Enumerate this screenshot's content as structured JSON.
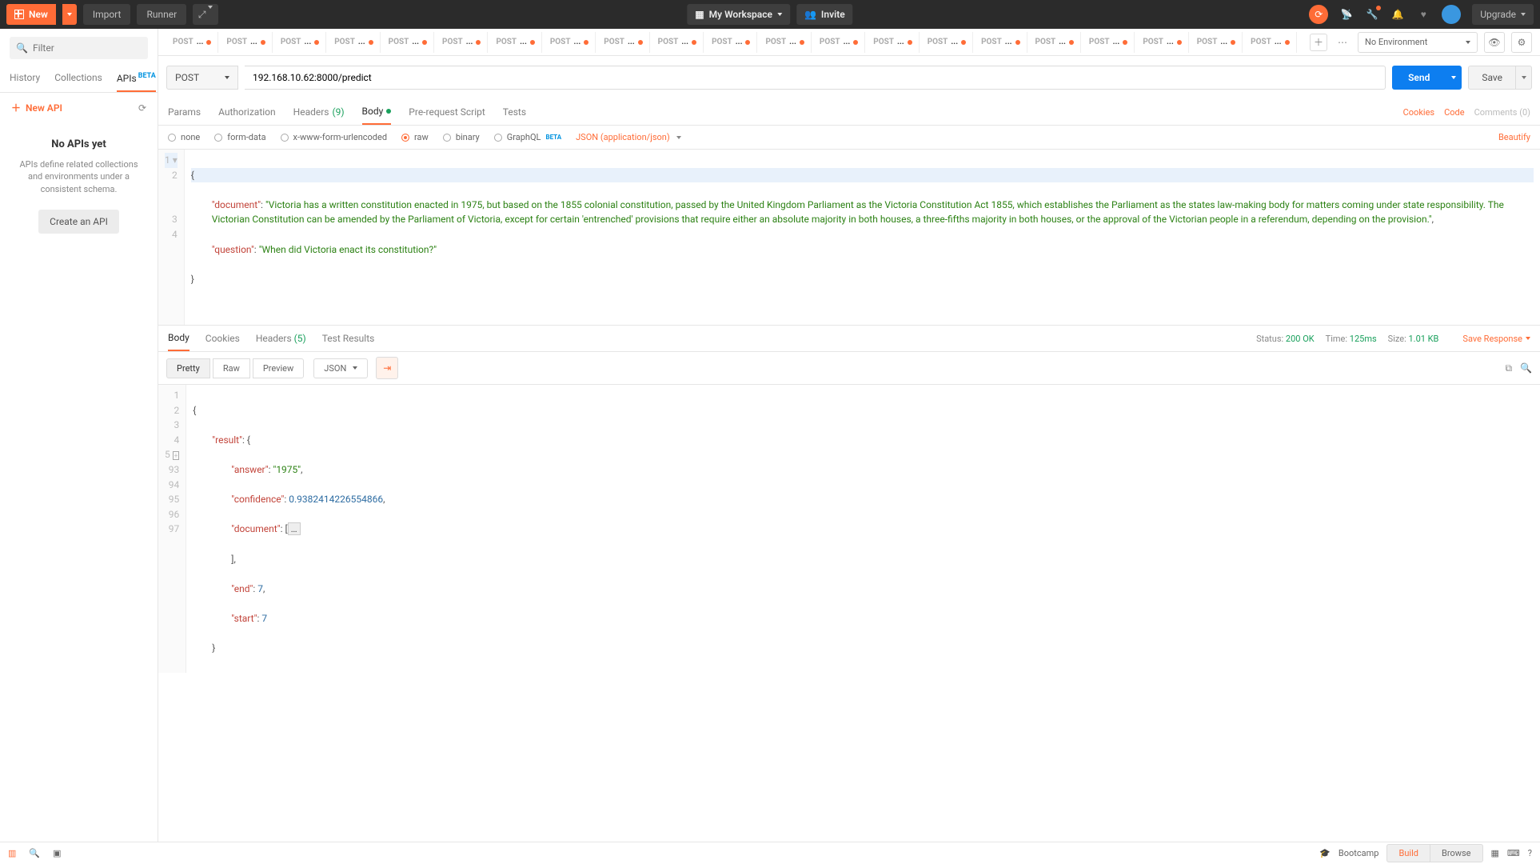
{
  "topbar": {
    "new_label": "New",
    "import_label": "Import",
    "runner_label": "Runner",
    "workspace_label": "My Workspace",
    "invite_label": "Invite",
    "upgrade_label": "Upgrade"
  },
  "sidebar": {
    "filter_placeholder": "Filter",
    "tabs": {
      "history": "History",
      "collections": "Collections",
      "apis": "APIs",
      "apis_badge": "BETA"
    },
    "new_api_label": "New API",
    "empty_title": "No APIs yet",
    "empty_desc": "APIs define related collections and environments under a consistent schema.",
    "create_api_label": "Create an API"
  },
  "env": {
    "selected": "No Environment"
  },
  "tabs": {
    "method": "POST",
    "label": "..."
  },
  "request": {
    "method": "POST",
    "url": "192.168.10.62:8000/predict",
    "send_label": "Send",
    "save_label": "Save",
    "subtabs": {
      "params": "Params",
      "auth": "Authorization",
      "headers": "Headers",
      "headers_count": "(9)",
      "body": "Body",
      "prerequest": "Pre-request Script",
      "tests": "Tests"
    },
    "links": {
      "cookies": "Cookies",
      "code": "Code",
      "comments": "Comments (0)"
    },
    "body_types": {
      "none": "none",
      "formdata": "form-data",
      "xwww": "x-www-form-urlencoded",
      "raw": "raw",
      "binary": "binary",
      "graphql": "GraphQL",
      "graphql_badge": "BETA",
      "raw_type": "JSON (application/json)",
      "beautify": "Beautify"
    },
    "body_json": {
      "line1": "{",
      "doc_key": "\"document\"",
      "doc_val": "\"Victoria has a written constitution enacted in 1975, but based on the 1855 colonial constitution, passed by the United Kingdom Parliament as the Victoria Constitution Act 1855, which establishes the Parliament as the states law-making body for matters coming under state responsibility. The Victorian Constitution can be amended by the Parliament of Victoria, except for certain 'entrenched' provisions that require either an absolute majority in both houses, a three-fifths majority in both houses, or the approval of the Victorian people in a referendum, depending on the provision.\"",
      "q_key": "\"question\"",
      "q_val": "\"When did Victoria enact its constitution?\"",
      "close": "}"
    }
  },
  "response": {
    "tabs": {
      "body": "Body",
      "cookies": "Cookies",
      "headers": "Headers",
      "headers_count": "(5)",
      "tests": "Test Results"
    },
    "status_label": "Status:",
    "status_val": "200 OK",
    "time_label": "Time:",
    "time_val": "125ms",
    "size_label": "Size:",
    "size_val": "1.01 KB",
    "save_resp": "Save Response",
    "view": {
      "pretty": "Pretty",
      "raw": "Raw",
      "preview": "Preview",
      "json": "JSON"
    },
    "body_lines": {
      "l1_n": "1",
      "l1": "{",
      "l2_n": "2",
      "l2_k": "\"result\"",
      "l2_v": ": {",
      "l3_n": "3",
      "l3_k": "\"answer\"",
      "l3_v": ": ",
      "l3_s": "\"1975\"",
      "l3_c": ",",
      "l4_n": "4",
      "l4_k": "\"confidence\"",
      "l4_v": ": ",
      "l4_num": "0.9382414226554866",
      "l4_c": ",",
      "l5_n": "5",
      "l5_k": "\"document\"",
      "l5_v": ": [",
      "l5_fold": "…",
      "l93_n": "93",
      "l93": "],",
      "l94_n": "94",
      "l94_k": "\"end\"",
      "l94_v": ": ",
      "l94_num": "7",
      "l94_c": ",",
      "l95_n": "95",
      "l95_k": "\"start\"",
      "l95_v": ": ",
      "l95_num": "7",
      "l96_n": "96",
      "l96": "}",
      "l97_n": "97",
      "l97": "}"
    }
  },
  "footer": {
    "bootcamp": "Bootcamp",
    "build": "Build",
    "browse": "Browse"
  }
}
